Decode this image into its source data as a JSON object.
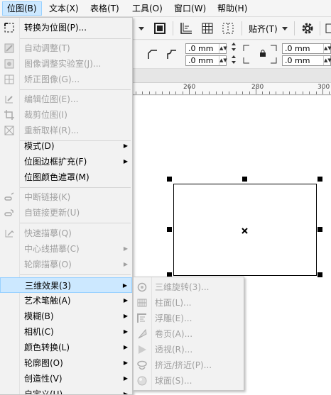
{
  "menubar": {
    "items": [
      {
        "label": "位图(B)"
      },
      {
        "label": "文本(X)"
      },
      {
        "label": "表格(T)"
      },
      {
        "label": "工具(O)"
      },
      {
        "label": "窗口(W)"
      },
      {
        "label": "帮助(H)"
      }
    ]
  },
  "toolbar": {
    "align_label": "贴齐(T)"
  },
  "property_bar": {
    "field1": ".0 mm",
    "field2": ".0 mm",
    "field3": ".0 mm",
    "field4": ".0 mm"
  },
  "ruler": {
    "labels": [
      "260",
      "280",
      "300"
    ]
  },
  "bitmap_menu": {
    "items": [
      {
        "label": "转换为位图(P)...",
        "icon": "convert-to-bitmap-icon",
        "enabled": true
      },
      {
        "label": "自动调整(T)",
        "icon": "auto-adjust-icon",
        "enabled": false
      },
      {
        "label": "图像调整实验室(J)...",
        "icon": "image-adjust-lab-icon",
        "enabled": false
      },
      {
        "label": "矫正图像(G)...",
        "icon": "straighten-image-icon",
        "enabled": false
      },
      {
        "label": "编辑位图(E)...",
        "icon": "edit-bitmap-icon",
        "enabled": false
      },
      {
        "label": "裁剪位图(I)",
        "icon": "crop-bitmap-icon",
        "enabled": false
      },
      {
        "label": "重新取样(R)...",
        "icon": "resample-icon",
        "enabled": false
      },
      {
        "label": "模式(D)",
        "icon": "",
        "enabled": true,
        "submenu": true
      },
      {
        "label": "位图边框扩充(F)",
        "icon": "",
        "enabled": true,
        "submenu": true
      },
      {
        "label": "位图颜色遮罩(M)",
        "icon": "",
        "enabled": true
      },
      {
        "label": "中断链接(K)",
        "icon": "break-link-icon",
        "enabled": false
      },
      {
        "label": "自链接更新(U)",
        "icon": "update-link-icon",
        "enabled": false
      },
      {
        "label": "快速描摹(Q)",
        "icon": "quick-trace-icon",
        "enabled": false
      },
      {
        "label": "中心线描摹(C)",
        "icon": "",
        "enabled": false,
        "submenu": true
      },
      {
        "label": "轮廓描摹(O)",
        "icon": "",
        "enabled": false,
        "submenu": true
      },
      {
        "label": "三维效果(3)",
        "icon": "",
        "enabled": true,
        "submenu": true,
        "highlighted": true
      },
      {
        "label": "艺术笔触(A)",
        "icon": "",
        "enabled": true,
        "submenu": true
      },
      {
        "label": "模糊(B)",
        "icon": "",
        "enabled": true,
        "submenu": true
      },
      {
        "label": "相机(C)",
        "icon": "",
        "enabled": true,
        "submenu": true
      },
      {
        "label": "颜色转换(L)",
        "icon": "",
        "enabled": true,
        "submenu": true
      },
      {
        "label": "轮廓图(O)",
        "icon": "",
        "enabled": true,
        "submenu": true
      },
      {
        "label": "创造性(V)",
        "icon": "",
        "enabled": true,
        "submenu": true
      },
      {
        "label": "自定义(U)",
        "icon": "",
        "enabled": true,
        "submenu": true
      }
    ]
  },
  "effects_3d_submenu": {
    "items": [
      {
        "label": "三维旋转(3)...",
        "icon": "3d-rotate-icon"
      },
      {
        "label": "柱面(L)...",
        "icon": "cylinder-icon"
      },
      {
        "label": "浮雕(E)...",
        "icon": "emboss-icon"
      },
      {
        "label": "卷页(A)...",
        "icon": "page-curl-icon"
      },
      {
        "label": "透视(R)...",
        "icon": "perspective-icon"
      },
      {
        "label": "挤远/挤近(P)...",
        "icon": "pinch-punch-icon"
      },
      {
        "label": "球面(S)...",
        "icon": "sphere-icon"
      }
    ]
  }
}
